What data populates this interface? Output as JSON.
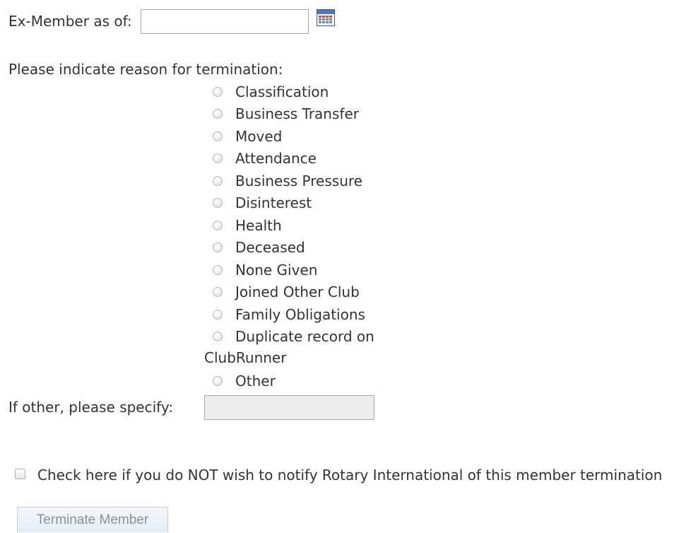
{
  "ex_member": {
    "label": "Ex-Member as of:",
    "date_value": "",
    "calendar_icon": "calendar-icon"
  },
  "reason": {
    "prompt": "Please indicate reason for termination:",
    "options": [
      {
        "label": "Classification",
        "checked": false
      },
      {
        "label": "Business Transfer",
        "checked": false
      },
      {
        "label": "Moved",
        "checked": false
      },
      {
        "label": "Attendance",
        "checked": false
      },
      {
        "label": "Business Pressure",
        "checked": false
      },
      {
        "label": "Disinterest",
        "checked": false
      },
      {
        "label": "Health",
        "checked": false
      },
      {
        "label": "Deceased",
        "checked": false
      },
      {
        "label": "None Given",
        "checked": false
      },
      {
        "label": "Joined Other Club",
        "checked": false
      },
      {
        "label": "Family Obligations",
        "checked": false
      },
      {
        "label": "Duplicate record on",
        "label_cont": "ClubRunner",
        "checked": false
      },
      {
        "label": "Other",
        "checked": false
      }
    ]
  },
  "other": {
    "label": "If other, please specify:",
    "value": ""
  },
  "notify": {
    "label": "Check here if you do NOT wish to notify Rotary International of this member termination",
    "checked": false
  },
  "actions": {
    "terminate_label": "Terminate Member"
  }
}
